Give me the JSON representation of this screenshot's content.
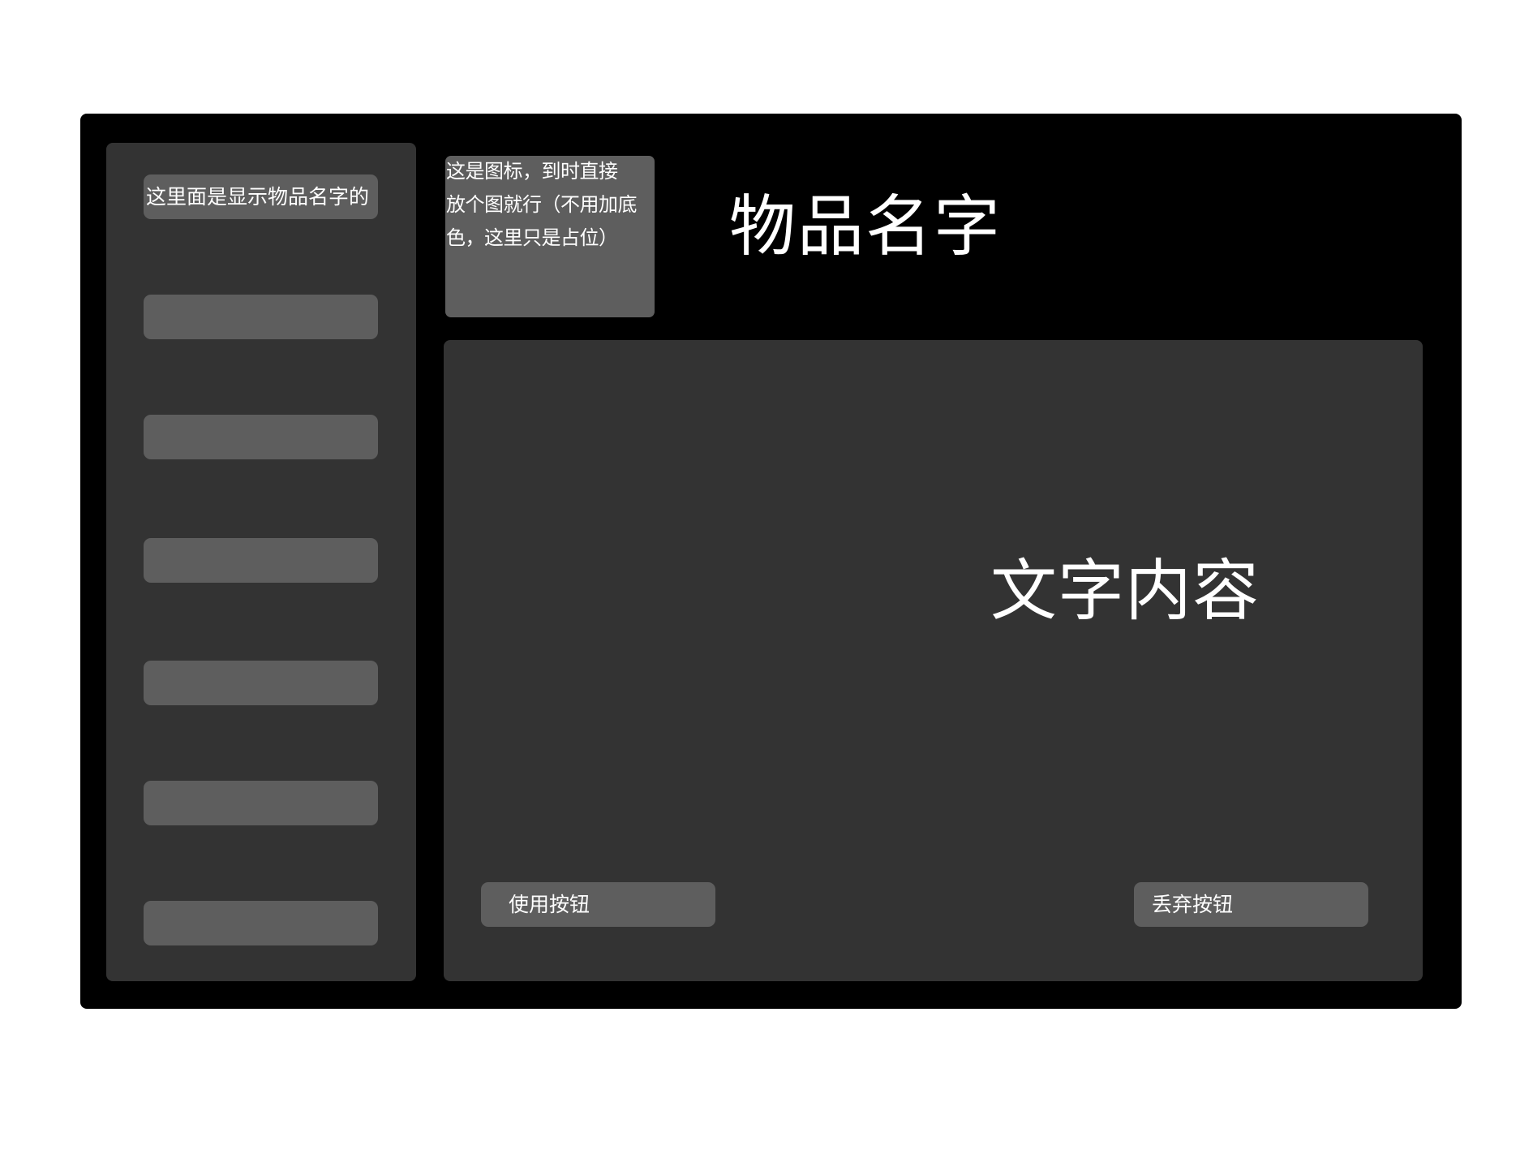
{
  "sidebar": {
    "items": [
      {
        "label": "这里面是显示物品名字的"
      },
      {
        "label": ""
      },
      {
        "label": ""
      },
      {
        "label": ""
      },
      {
        "label": ""
      },
      {
        "label": ""
      },
      {
        "label": ""
      }
    ]
  },
  "item": {
    "icon_placeholder_lines": [
      "这是图标，到时直接",
      "放个图就行（不用加底",
      "色，这里只是占位）"
    ],
    "name": "物品名字",
    "description": "文字内容"
  },
  "actions": {
    "use_label": "使用按钮",
    "discard_label": "丢弃按钮"
  },
  "colors": {
    "page_background": "#ffffff",
    "window_background": "#000000",
    "panel_background": "#333333",
    "slot_background": "#5e5e5e",
    "text": "#ffffff"
  }
}
